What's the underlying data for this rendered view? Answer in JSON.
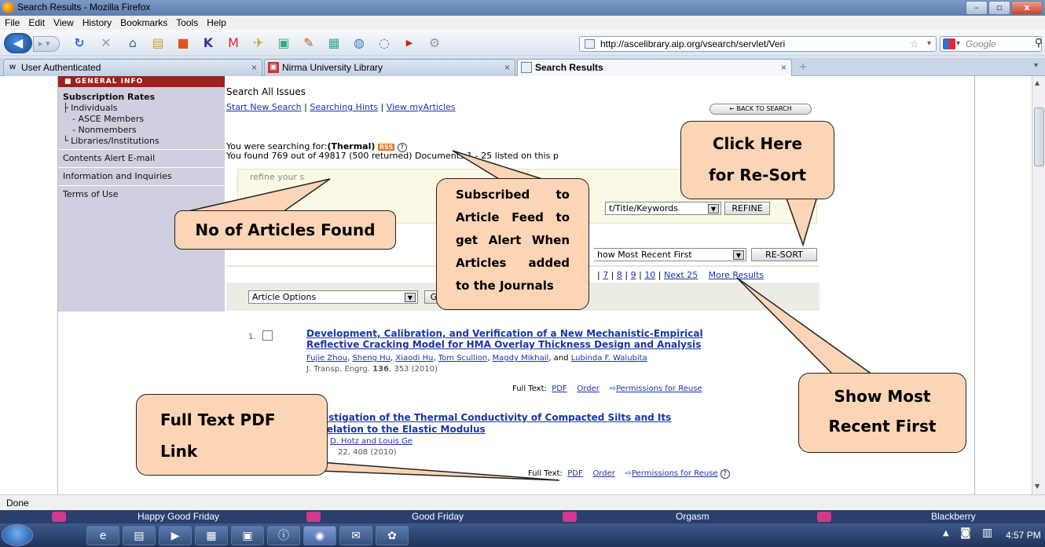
{
  "window": {
    "title": "Search Results - Mozilla Firefox"
  },
  "menu": [
    "File",
    "Edit",
    "View",
    "History",
    "Bookmarks",
    "Tools",
    "Help"
  ],
  "nav": {
    "url": "http://ascelibrary.aip.org/vsearch/servlet/Veri",
    "search_placeholder": "Google"
  },
  "tabs": [
    {
      "label": "User Authenticated",
      "icon": "w-icon"
    },
    {
      "label": "Nirma University Library",
      "icon": "library-icon"
    },
    {
      "label": "Search Results",
      "icon": "page-icon",
      "active": true
    }
  ],
  "sidebar": {
    "header": "GENERAL INFO",
    "items": [
      {
        "label": "Subscription Rates",
        "bold": true
      },
      {
        "label": "Individuals"
      },
      {
        "label": "- ASCE Members"
      },
      {
        "label": "- Nonmembers"
      },
      {
        "label": "Libraries/Institutions"
      },
      {
        "label": "Contents Alert E-mail"
      },
      {
        "label": "Information and Inquiries"
      },
      {
        "label": "Terms of Use"
      }
    ]
  },
  "main": {
    "heading": "Search All Issues",
    "links": [
      "Start New Search",
      "Searching Hints",
      "View myArticles"
    ],
    "back_button": "← BACK TO SEARCH",
    "searching_for_prefix": "You were searching for:",
    "searching_for_term": "(Thermal)",
    "rss_label": "RSS",
    "found_text": "You found 769 out of 49817 (500 returned) Documents 1 - 25 listed on this p",
    "refine_label": "refine your s",
    "refine_select": "t/Title/Keywords",
    "refine_button": "REFINE",
    "sort_select": "how Most Recent First",
    "resort_button": "RE-SORT",
    "pagination": [
      "7",
      "8",
      "9",
      "10",
      "Next 25",
      "More Results"
    ],
    "article_options": "Article Options",
    "go_button": "G"
  },
  "results": [
    {
      "number": "1.",
      "title_line1": "Development, Calibration, and Verification of a New Mechanistic-Empirical",
      "title_line2": "Reflective Cracking Model for HMA Overlay Thickness Design and Analysis",
      "authors": [
        "Fujie Zhou",
        "Sheng Hu",
        "Xiaodi Hu",
        "Tom Scullion",
        "Magdy Mikhail",
        "Lubinda F. Walubita"
      ],
      "citation_prefix": "J. Transp. Engrg. ",
      "citation_vol": "136",
      "citation_suffix": ", 353 (2010)",
      "full_text_label": "Full Text:",
      "pdf": "PDF",
      "order": "Order",
      "permissions": "Permissions for Reuse"
    },
    {
      "title_line1": "estigation of the Thermal Conductivity of Compacted Silts and Its",
      "title_line2": "relation to the Elastic Modulus",
      "authors_text": "D. Hotz and Louis Ge",
      "citation": "22, 408 (2010)",
      "full_text_label": "Full Text:",
      "pdf": "PDF",
      "order": "Order",
      "permissions": "Permissions for Reuse"
    }
  ],
  "callouts": {
    "articles_found": "No of Articles Found",
    "subscribed_feed": [
      "Subscribed to",
      "Article Feed to",
      "get Alert When",
      "Articles added",
      "to the Journals"
    ],
    "resort": [
      "Click Here",
      "for Re-Sort"
    ],
    "most_recent": [
      "Show Most",
      "Recent First"
    ],
    "pdf_link": [
      "Full Text PDF",
      "Link"
    ]
  },
  "status": "Done",
  "bookmarks": [
    "Happy Good Friday",
    "Good Friday",
    "Orgasm",
    "Blackberry"
  ],
  "clock": "4:57 PM",
  "colors": {
    "callout_fill": "#fbd5b5",
    "link": "#1a35a8",
    "rss": "#e8741c",
    "sidebar_header": "#a02020"
  }
}
